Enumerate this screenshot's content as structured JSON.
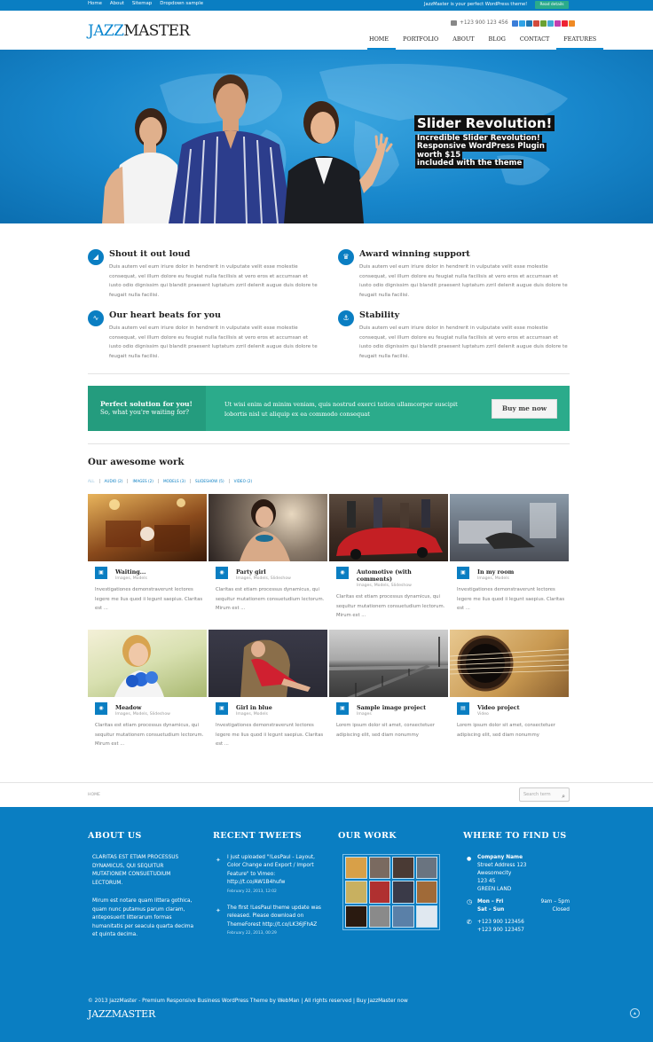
{
  "topbar": {
    "links": [
      "Home",
      "About",
      "Sitemap",
      "Dropdown sample"
    ],
    "promo": "JazzMaster is your perfect WordPress theme!",
    "button": "Read details"
  },
  "header": {
    "logo_a": "JAZZ",
    "logo_b": "MASTER",
    "phone": "+123 900 123 456",
    "nav": [
      "HOME",
      "PORTFOLIO",
      "ABOUT",
      "BLOG",
      "CONTACT",
      "FEATURES"
    ]
  },
  "hero": {
    "title": "Slider Revolution!",
    "lines": [
      "Incredible Slider Revolution!",
      "Responsive WordPress Plugin",
      "worth $15",
      "included with the theme"
    ]
  },
  "features": [
    {
      "title": "Shout it out loud",
      "text": "Duis autem vel eum iriure dolor in hendrerit in vulputate velit esse molestie consequat, vel illum dolore eu feugiat nulla facilisis at vero eros et accumsan et iusto odio dignissim qui blandit praesent luptatum zzril delenit augue duis dolore te feugait nulla facilisi."
    },
    {
      "title": "Award winning support",
      "text": "Duis autem vel eum iriure dolor in hendrerit in vulputate velit esse molestie consequat, vel illum dolore eu feugiat nulla facilisis at vero eros et accumsan et iusto odio dignissim qui blandit praesent luptatum zzril delenit augue duis dolore te feugait nulla facilisi."
    },
    {
      "title": "Our heart beats for you",
      "text": "Duis autem vel eum iriure dolor in hendrerit in vulputate velit esse molestie consequat, vel illum dolore eu feugiat nulla facilisis at vero eros et accumsan et iusto odio dignissim qui blandit praesent luptatum zzril delenit augue duis dolore te feugait nulla facilisi."
    },
    {
      "title": "Stability",
      "text": "Duis autem vel eum iriure dolor in hendrerit in vulputate velit esse molestie consequat, vel illum dolore eu feugiat nulla facilisis at vero eros et accumsan et iusto odio dignissim qui blandit praesent luptatum zzril delenit augue duis dolore te feugait nulla facilisi."
    }
  ],
  "cta": {
    "line1": "Perfect solution for you!",
    "line2": "So, what you're waiting for?",
    "text": "Ut wisi enim ad minim veniam, quis nostrud exerci tation ullamcorper suscipit lobortis nisl ut aliquip ex ea commodo consequat",
    "button": "Buy me now"
  },
  "portfolio": {
    "title": "Our awesome work",
    "filters": [
      "ALL",
      "AUDIO (2)",
      "IMAGES (2)",
      "MODELS (3)",
      "SLIDESHOW (5)",
      "VIDEO (2)"
    ],
    "items": [
      {
        "title": "Waiting...",
        "cats": "Images, Models",
        "desc": "Investigationes demonstraverunt lectores legere me lius quod ii legunt saepius. Claritas est ..."
      },
      {
        "title": "Party girl",
        "cats": "Images, Models, Slideshow",
        "desc": "Claritas est etiam processus dynamicus, qui sequitur mutationem consuetudium lectorum. Mirum est ..."
      },
      {
        "title": "Automotive (with comments)",
        "cats": "Images, Models, Slideshow",
        "desc": "Claritas est etiam processus dynamicus, qui sequitur mutationem consuetudium lectorum. Mirum est ..."
      },
      {
        "title": "In my room",
        "cats": "Images, Models",
        "desc": "Investigationes demonstraverunt lectores legere me lius quod ii legunt saepius. Claritas est ..."
      },
      {
        "title": "Meadow",
        "cats": "Images, Models, Slideshow",
        "desc": "Claritas est etiam processus dynamicus, qui sequitur mutationem consuetudium lectorum. Mirum est ..."
      },
      {
        "title": "Girl in blue",
        "cats": "Images, Models",
        "desc": "Investigationes demonstraverunt lectores legere me lius quod ii legunt saepius. Claritas est ..."
      },
      {
        "title": "Sample image project",
        "cats": "Images",
        "desc": "Lorem ipsum dolor sit amet, consectetuer adipiscing elit, sed diam nonummy"
      },
      {
        "title": "Video project",
        "cats": "Video",
        "desc": "Lorem ipsum dolor sit amet, consectetuer adipiscing elit, sed diam nonummy"
      }
    ]
  },
  "crumb": "HOME",
  "search_placeholder": "Search term",
  "footer": {
    "about_title": "ABOUT US",
    "about_caps": "CLARITAS EST ETIAM PROCESSUS DYNAMICUS, QUI SEQUITUR MUTATIONEM CONSUETUDIUM LECTORUM.",
    "about_text": "Mirum est notare quam littera gothica, quam nunc putamus parum claram, anteposuerit litterarum formas humanitatis per seacula quarta decima et quinta decima.",
    "tweets_title": "RECENT TWEETS",
    "tweets": [
      {
        "text": "I just uploaded \"!LesPaul - Layout, Color Change and Export / Import Feature\" to Vimeo: http://t.co/AW1B4hufw",
        "date": "February 22, 2013, 12:02"
      },
      {
        "text": "The first !LesPaul theme update was released. Please download on ThemeForest http://t.co/LK36JFhAZ",
        "date": "February 22, 2013, 00:29"
      }
    ],
    "work_title": "OUR WORK",
    "find_title": "WHERE TO FIND US",
    "company": "Company Name",
    "address": [
      "Street Address 123",
      "Awesomecity",
      "123 45",
      "GREEN LAND"
    ],
    "hours": [
      {
        "days": "Mon – Fri",
        "time": "9am – 5pm"
      },
      {
        "days": "Sat – Sun",
        "time": "Closed"
      }
    ],
    "phones": [
      "+123 900 123456",
      "+123 900 123457"
    ],
    "copyright": "© 2013 JazzMaster - Premium Responsive Business WordPress Theme by WebMan | All rights reserved | Buy JazzMaster now",
    "logo": "JAZZMASTER"
  }
}
